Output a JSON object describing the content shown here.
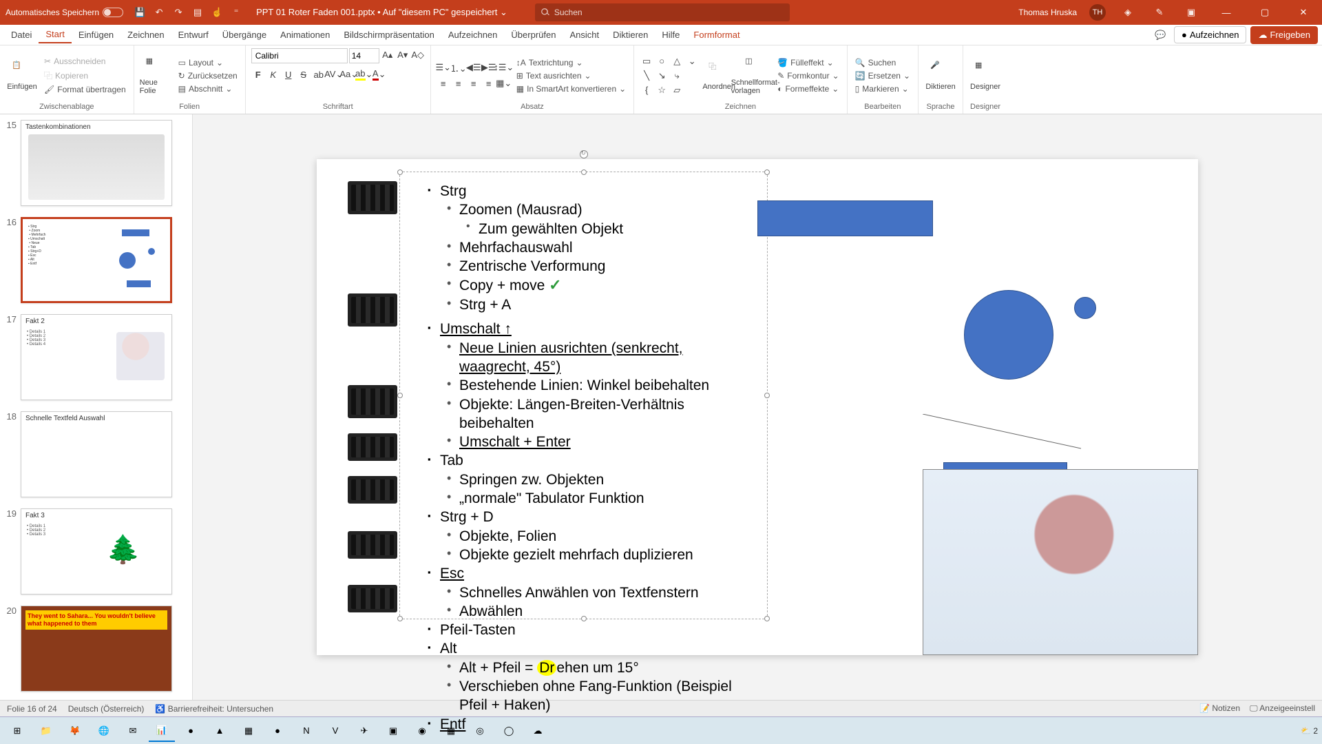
{
  "title_bar": {
    "autosave": "Automatisches Speichern",
    "doc_title": "PPT 01 Roter Faden 001.pptx • Auf \"diesem PC\" gespeichert ⌄",
    "search_placeholder": "Suchen",
    "user_name": "Thomas Hruska",
    "user_initials": "TH"
  },
  "menu": {
    "items": [
      "Datei",
      "Start",
      "Einfügen",
      "Zeichnen",
      "Entwurf",
      "Übergänge",
      "Animationen",
      "Bildschirmpräsentation",
      "Aufzeichnen",
      "Überprüfen",
      "Ansicht",
      "Diktieren",
      "Hilfe"
    ],
    "contextual": "Formformat",
    "record": "Aufzeichnen",
    "share": "Freigeben"
  },
  "ribbon": {
    "clipboard": {
      "label": "Zwischenablage",
      "paste": "Einfügen",
      "cut": "Ausschneiden",
      "copy": "Kopieren",
      "format": "Format übertragen"
    },
    "slides": {
      "label": "Folien",
      "new": "Neue Folie",
      "layout": "Layout",
      "reset": "Zurücksetzen",
      "section": "Abschnitt"
    },
    "font": {
      "label": "Schriftart",
      "name": "Calibri",
      "size": "14"
    },
    "paragraph": {
      "label": "Absatz",
      "textdir": "Textrichtung",
      "align": "Text ausrichten",
      "smartart": "In SmartArt konvertieren"
    },
    "drawing": {
      "label": "Zeichnen",
      "arrange": "Anordnen",
      "quickstyles": "Schnellformat-\nvorlagen",
      "fill": "Fülleffekt",
      "outline": "Formkontur",
      "effects": "Formeffekte"
    },
    "editing": {
      "label": "Bearbeiten",
      "find": "Suchen",
      "replace": "Ersetzen",
      "select": "Markieren"
    },
    "voice": {
      "label": "Sprache",
      "dictate": "Diktieren"
    },
    "designer": {
      "label": "Designer",
      "designer": "Designer"
    }
  },
  "thumbs": [
    {
      "num": "15",
      "title": "Tastenkombinationen"
    },
    {
      "num": "16",
      "title": ""
    },
    {
      "num": "17",
      "title": "Fakt 2"
    },
    {
      "num": "18",
      "title": "Schnelle Textfeld Auswahl"
    },
    {
      "num": "19",
      "title": "Fakt 3"
    },
    {
      "num": "20",
      "title": "They went to Sahara... You wouldn't believe what happened to them"
    }
  ],
  "slide": {
    "bullets": {
      "strg": "Strg",
      "zoom": "Zoomen (Mausrad)",
      "zoom_obj": "Zum gewählten Objekt",
      "mehrfach": "Mehrfachauswahl",
      "zentrische": "Zentrische Verformung",
      "copymove": "Copy + move",
      "strga": "Strg + A",
      "umschalt": "Umschalt  ↑",
      "neue": "Neue Linien ausrichten (senkrecht, waagrecht, 45°)",
      "bestehende": "Bestehende Linien: Winkel beibehalten",
      "objekte": "Objekte: Längen-Breiten-Verhältnis beibehalten",
      "umenter": "Umschalt + Enter",
      "tab": "Tab",
      "springen": "Springen zw. Objekten",
      "normale": "„normale\" Tabulator Funktion",
      "strgd": "Strg + D",
      "objfolien": "Objekte, Folien",
      "gezielt": "Objekte gezielt mehrfach duplizieren",
      "esc": "Esc",
      "schnelles": "Schnelles Anwählen von Textfenstern",
      "abwahlen": "Abwählen",
      "pfeil": "Pfeil-Tasten",
      "alt": "Alt",
      "altpfeil": "Alt + Pfeil = Drehen um 15°",
      "verschieben": "Verschieben ohne Fang-Funktion (Beispiel Pfeil + Haken)",
      "entf": "Entf"
    }
  },
  "status": {
    "slide_count": "Folie 16 of 24",
    "lang": "Deutsch (Österreich)",
    "accessibility": "Barrierefreiheit: Untersuchen",
    "notes": "Notizen",
    "display": "Anzeigeeinstell"
  },
  "taskbar_right": "⛅ 2"
}
